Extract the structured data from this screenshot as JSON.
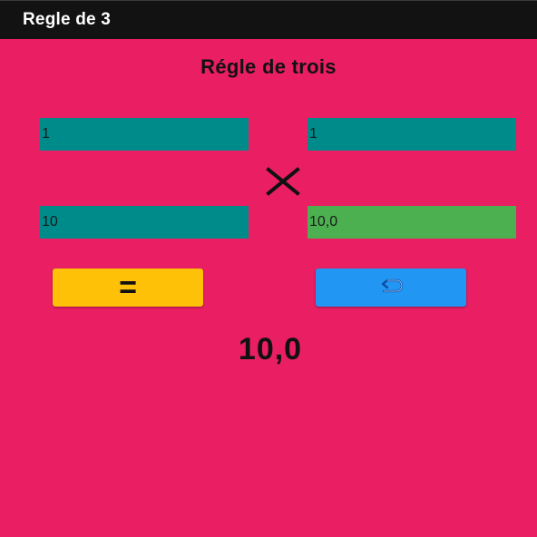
{
  "app_bar": {
    "title": "Regle de 3"
  },
  "heading": "Régle de trois",
  "inputs": {
    "top_left": "1",
    "top_right": "1",
    "bottom_left": "10",
    "bottom_right": "10,0"
  },
  "operator_icon": "multiply-icon",
  "buttons": {
    "equals_label": "=",
    "reset_icon": "undo-icon"
  },
  "result": "10,0",
  "colors": {
    "background": "#E91E63",
    "app_bar": "#121212",
    "input_field": "#008B8B",
    "result_field": "#4CAF50",
    "equals_button": "#FFC107",
    "reset_button": "#2196F3"
  }
}
